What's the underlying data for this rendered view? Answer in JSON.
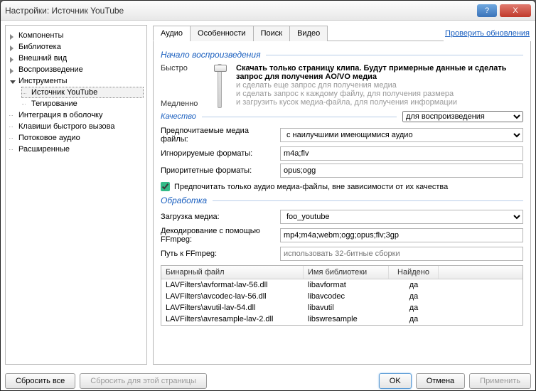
{
  "window": {
    "title": "Настройки: Источник YouTube"
  },
  "titlebar": {
    "help": "?",
    "close": "X"
  },
  "tree": {
    "items": [
      {
        "label": "Компоненты"
      },
      {
        "label": "Библиотека"
      },
      {
        "label": "Внешний вид"
      },
      {
        "label": "Воспроизведение"
      },
      {
        "label": "Инструменты",
        "expanded": true,
        "children": [
          {
            "label": "Источник YouTube",
            "selected": true
          },
          {
            "label": "Тегирование"
          }
        ]
      },
      {
        "label": "Интеграция в оболочку"
      },
      {
        "label": "Клавиши быстрого вызова"
      },
      {
        "label": "Потоковое аудио"
      },
      {
        "label": "Расширенные"
      }
    ]
  },
  "tabs": {
    "items": [
      "Аудио",
      "Особенности",
      "Поиск",
      "Видео"
    ],
    "active": 0
  },
  "check_updates": "Проверить обновления",
  "sections": {
    "playback": {
      "title": "Начало воспроизведения",
      "fast": "Быстро",
      "slow": "Медленно",
      "lines": [
        "Скачать только страницу клипа. Будут примерные данные и сделать запрос для получения AO/VO медиа",
        "и сделать еще запрос для получения медиа",
        "и сделать запрос к каждому файлу, для получения размера",
        "и загрузить кусок медиа-файла, для получения информации"
      ]
    },
    "quality": {
      "title": "Качество",
      "mode": "для воспроизведения",
      "pref_label": "Предпочитаемые медиа файлы:",
      "pref_value": "с наилучшими имеющимися аудио",
      "ignore_label": "Игнорируемые форматы:",
      "ignore_value": "m4a;flv",
      "priority_label": "Приоритетные форматы:",
      "priority_value": "opus;ogg",
      "checkbox": "Предпочитать только аудио медиа-файлы, вне зависимости от их качества"
    },
    "processing": {
      "title": "Обработка",
      "load_label": "Загрузка медиа:",
      "load_value": "foo_youtube",
      "decode_label": "Декодирование с помощью FFmpeg:",
      "decode_value": "mp4;m4a;webm;ogg;opus;flv;3gp",
      "path_label": "Путь к FFmpeg:",
      "path_placeholder": "использовать 32-битные сборки",
      "table": {
        "headers": [
          "Бинарный файл",
          "Имя библиотеки",
          "Найдено"
        ],
        "rows": [
          [
            "LAVFilters\\avformat-lav-56.dll",
            "libavformat",
            "да"
          ],
          [
            "LAVFilters\\avcodec-lav-56.dll",
            "libavcodec",
            "да"
          ],
          [
            "LAVFilters\\avutil-lav-54.dll",
            "libavutil",
            "да"
          ],
          [
            "LAVFilters\\avresample-lav-2.dll",
            "libswresample",
            "да"
          ]
        ]
      }
    }
  },
  "footer": {
    "reset_all": "Сбросить все",
    "reset_page": "Сбросить для этой страницы",
    "ok": "OK",
    "cancel": "Отмена",
    "apply": "Применить"
  }
}
